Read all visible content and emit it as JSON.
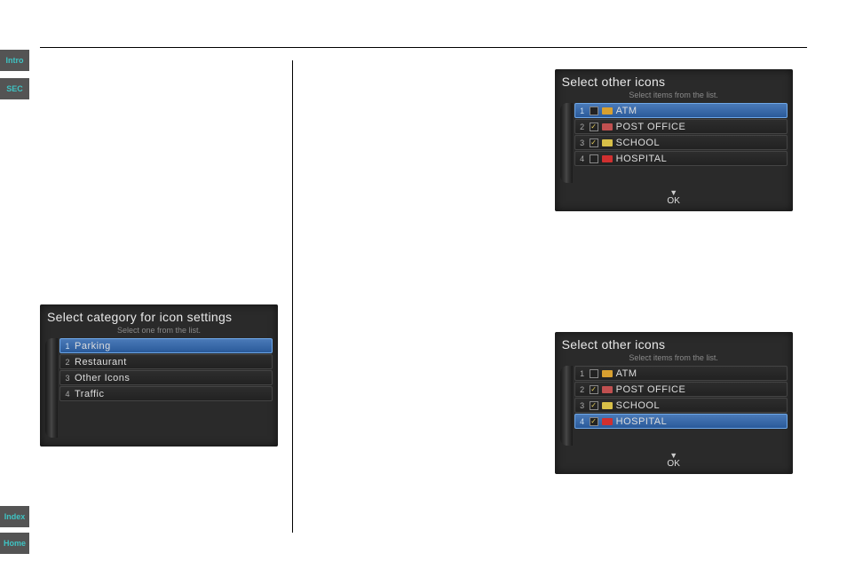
{
  "sidebar": {
    "intro": "Intro",
    "sec": "SEC",
    "index": "Index",
    "home": "Home"
  },
  "screenA": {
    "title": "Select category for icon settings",
    "subtitle": "Select one from the list.",
    "rows": [
      {
        "num": "1",
        "label": "Parking"
      },
      {
        "num": "2",
        "label": "Restaurant"
      },
      {
        "num": "3",
        "label": "Other Icons"
      },
      {
        "num": "4",
        "label": "Traffic"
      }
    ]
  },
  "screenB": {
    "title": "Select other icons",
    "subtitle": "Select items from the list.",
    "ok": "OK",
    "rows": [
      {
        "num": "1",
        "checked": false,
        "icon": "atm",
        "label": "ATM"
      },
      {
        "num": "2",
        "checked": true,
        "icon": "post",
        "label": "POST OFFICE"
      },
      {
        "num": "3",
        "checked": true,
        "icon": "school",
        "label": "SCHOOL"
      },
      {
        "num": "4",
        "checked": false,
        "icon": "hospital",
        "label": "HOSPITAL"
      }
    ]
  },
  "screenC": {
    "title": "Select other icons",
    "subtitle": "Select items from the list.",
    "ok": "OK",
    "rows": [
      {
        "num": "1",
        "checked": false,
        "icon": "atm",
        "label": "ATM"
      },
      {
        "num": "2",
        "checked": true,
        "icon": "post",
        "label": "POST OFFICE"
      },
      {
        "num": "3",
        "checked": true,
        "icon": "school",
        "label": "SCHOOL"
      },
      {
        "num": "4",
        "checked": true,
        "icon": "hospital",
        "label": "HOSPITAL"
      }
    ]
  }
}
